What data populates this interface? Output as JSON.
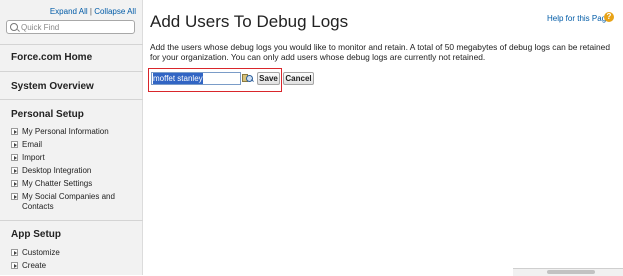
{
  "sidebar": {
    "expand_all": "Expand All",
    "separator": "|",
    "collapse_all": "Collapse All",
    "quick_find_placeholder": "Quick Find",
    "force_home": "Force.com Home",
    "system_overview": "System Overview",
    "personal_setup": {
      "title": "Personal Setup",
      "items": [
        {
          "label": "My Personal Information"
        },
        {
          "label": "Email"
        },
        {
          "label": "Import"
        },
        {
          "label": "Desktop Integration"
        },
        {
          "label": "My Chatter Settings"
        },
        {
          "label": "My Social Companies and Contacts"
        }
      ]
    },
    "app_setup": {
      "title": "App Setup",
      "items": [
        {
          "label": "Customize"
        },
        {
          "label": "Create"
        }
      ]
    }
  },
  "main": {
    "title": "Add Users To Debug Logs",
    "help_link": "Help for this Page",
    "help_icon": "?",
    "description": "Add the users whose debug logs you would like to monitor and retain. A total of 50 megabytes of debug logs can be retained for your organization. You can only add users whose debug logs are currently not retained.",
    "user_value": "moffet stanley",
    "save_label": "Save",
    "cancel_label": "Cancel"
  },
  "colors": {
    "link": "#015ba7",
    "highlight_border": "#d9262b",
    "selection": "#3165c4",
    "sidebar_bg": "#f2f2f2"
  }
}
